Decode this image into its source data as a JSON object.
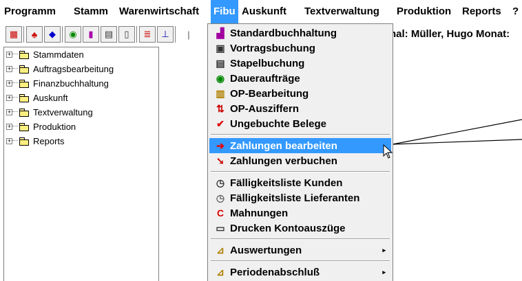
{
  "menubar": {
    "items": [
      "Programm",
      "Stamm",
      "Warenwirtschaft",
      "Fibu",
      "Auskunft",
      "Textverwaltung",
      "Produktion",
      "Reports",
      "?"
    ]
  },
  "info": {
    "text": "nal: Müller, Hugo  Monat:"
  },
  "tree": {
    "items": [
      "Stammdaten",
      "Auftragsbearbeitung",
      "Finanzbuchhaltung",
      "Auskunft",
      "Textverwaltung",
      "Produktion",
      "Reports"
    ],
    "expander": "+"
  },
  "fibu_menu": {
    "groups": [
      [
        {
          "label": "Standardbuchhaltung",
          "icon": "chart-icon"
        },
        {
          "label": "Vortragsbuchung",
          "icon": "document-icon"
        },
        {
          "label": "Stapelbuchung",
          "icon": "stack-icon"
        },
        {
          "label": "Daueraufträge",
          "icon": "cycle-icon"
        },
        {
          "label": "OP-Bearbeitung",
          "icon": "printer-icon"
        },
        {
          "label": "OP-Ausziffern",
          "icon": "arrows-icon"
        },
        {
          "label": "Ungebuchte Belege",
          "icon": "checkmark-icon"
        }
      ],
      [
        {
          "label": "Zahlungen bearbeiten",
          "icon": "arrow-right-icon",
          "highlighted": true
        },
        {
          "label": "Zahlungen verbuchen",
          "icon": "hammer-icon"
        }
      ],
      [
        {
          "label": "Fälligkeitsliste Kunden",
          "icon": "clock-icon"
        },
        {
          "label": "Fälligkeitsliste Lieferanten",
          "icon": "clock-icon"
        },
        {
          "label": "Mahnungen",
          "icon": "warning-icon"
        },
        {
          "label": "Drucken Kontoauszüge",
          "icon": "statement-icon"
        }
      ],
      [
        {
          "label": "Auswertungen",
          "icon": "folder-open-icon",
          "submenu": true
        }
      ],
      [
        {
          "label": "Periodenabschluß",
          "icon": "folder-open-icon",
          "submenu": true
        }
      ]
    ],
    "submenu_glyph": "▸"
  },
  "colors": {
    "highlight": "#3399ff",
    "menu_bg": "#f0f0f0"
  }
}
